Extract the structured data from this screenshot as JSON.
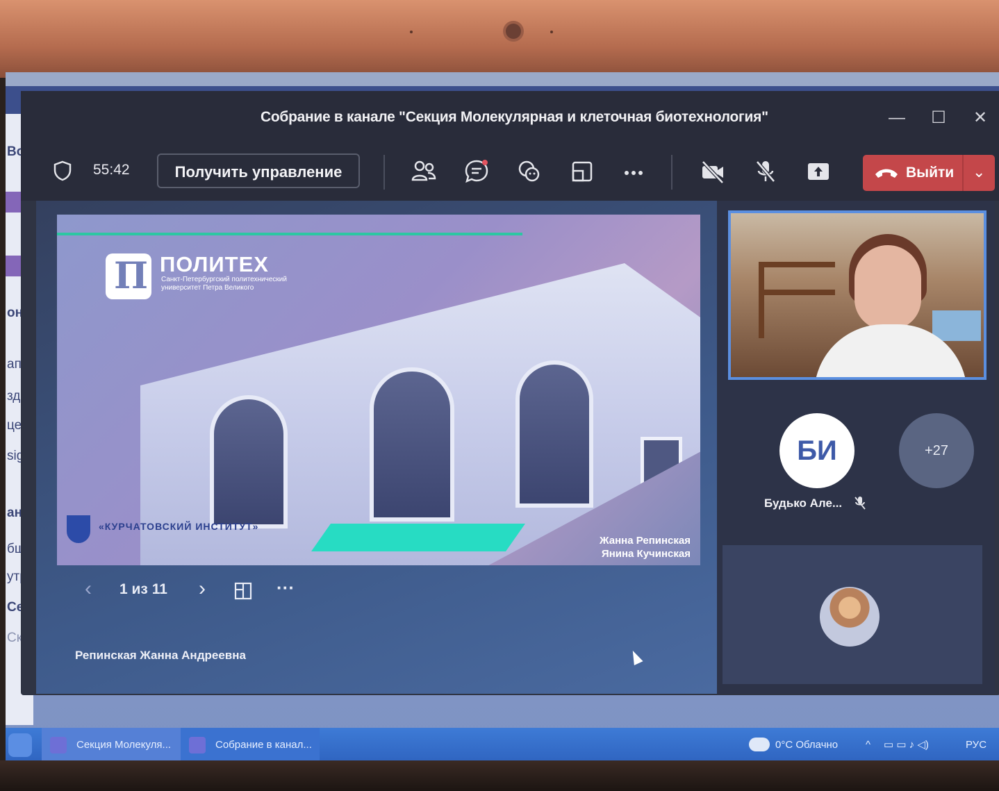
{
  "window": {
    "title": "Собрание в канале \"Секция Молекулярная и клеточная биотехнология\"",
    "minimize_icon": "minimize-icon",
    "maximize_icon": "maximize-icon",
    "close_icon": "close-icon"
  },
  "toolbar": {
    "timer": "55:42",
    "take_control_label": "Получить управление",
    "leave_label": "Выйти",
    "icons": [
      "shield-icon",
      "participants-icon",
      "chat-icon",
      "reactions-icon",
      "share-tray-icon",
      "more-icon",
      "camera-off-icon",
      "mic-off-icon",
      "share-icon",
      "phone-icon",
      "chevron-down-icon"
    ]
  },
  "slide": {
    "brand": "ПОЛИТЕХ",
    "brand_sub": "Санкт-Петербургский политехнический университет Петра Великого",
    "institute": "«КУРЧАТОВСКИЙ ИНСТИТУТ»",
    "authors": [
      "Жанна Репинская",
      "Янина Кучинская"
    ],
    "counter": "1 из 11"
  },
  "presenter_name": "Репинская Жанна Андреевна",
  "participants": {
    "initials": "БИ",
    "name": "Будько Але...",
    "more_count": "+27"
  },
  "taskbar": {
    "apps": [
      "Секция Молекуля...",
      "Собрание в канал..."
    ],
    "weather": "0°C Облачно",
    "lang": "РУС"
  },
  "left_panel_fragments": [
    "Во",
    "он",
    "апи",
    "зда",
    "цен",
    "sig",
    "ана.",
    "бщ",
    "утр",
    "Секц",
    "Скры"
  ],
  "colors": {
    "leave_red": "#c4474a",
    "accent_blue": "#5b8fe0",
    "teams_bg": "#2f3443"
  }
}
